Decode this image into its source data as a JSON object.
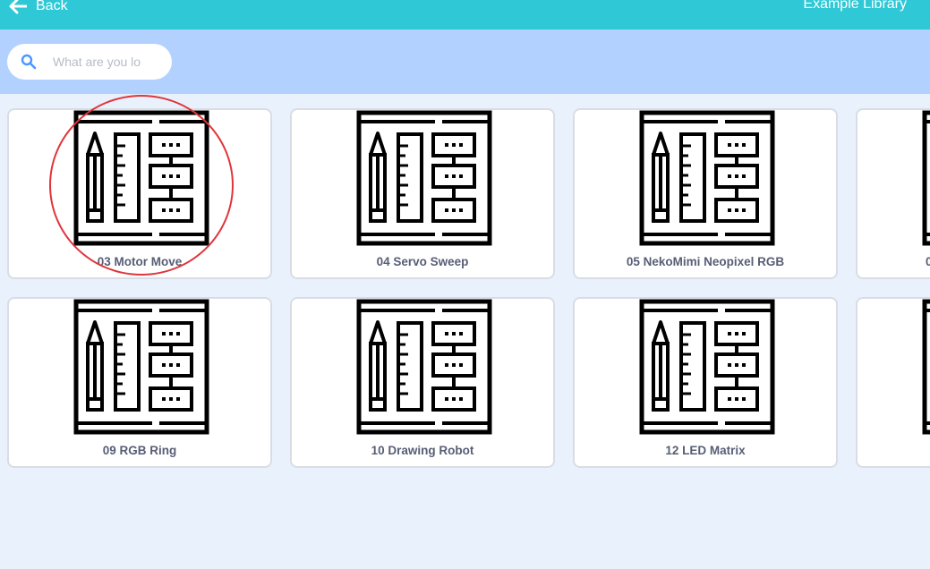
{
  "header": {
    "back_label": "Back",
    "title": "Example Library",
    "colors": {
      "header_bg": "#2ec8d6",
      "filter_bg": "#b3d1fe",
      "page_bg": "#e9f1fc"
    }
  },
  "search": {
    "placeholder": "What are you lo",
    "value": ""
  },
  "examples": [
    {
      "label": "03 Motor Move",
      "icon": "blueprint-icon"
    },
    {
      "label": "04 Servo Sweep",
      "icon": "blueprint-icon"
    },
    {
      "label": "05 NekoMimi Neopixel RGB",
      "icon": "blueprint-icon"
    },
    {
      "label": "0",
      "icon": "blueprint-icon"
    },
    {
      "label": "09 RGB Ring",
      "icon": "blueprint-icon"
    },
    {
      "label": "10 Drawing Robot",
      "icon": "blueprint-icon"
    },
    {
      "label": "12 LED Matrix",
      "icon": "blueprint-icon"
    },
    {
      "label": "",
      "icon": "blueprint-icon"
    }
  ],
  "annotation": {
    "highlight_color": "#e0343a"
  }
}
